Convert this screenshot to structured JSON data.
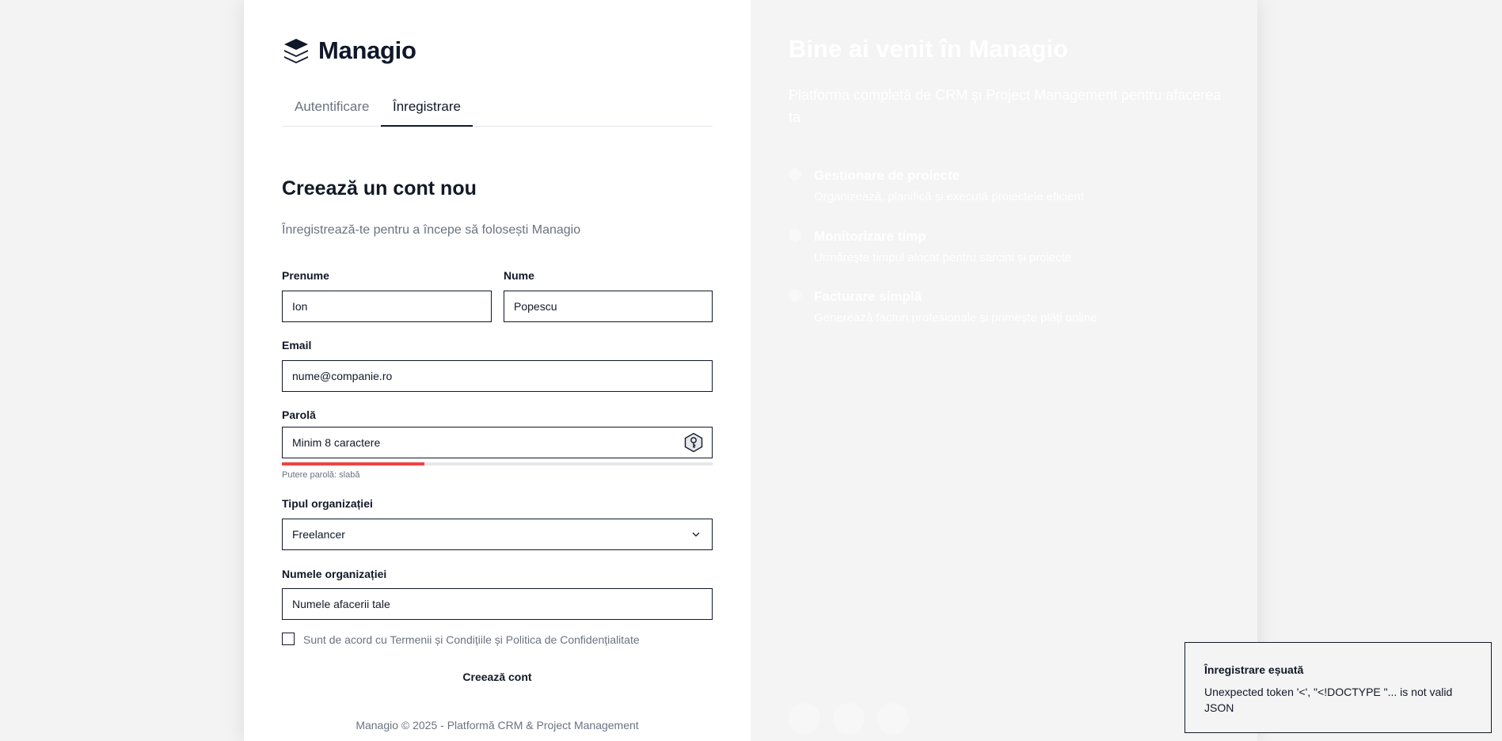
{
  "brand": {
    "name": "Managio"
  },
  "tabs": [
    {
      "label": "Autentificare",
      "active": false
    },
    {
      "label": "Înregistrare",
      "active": true
    }
  ],
  "form": {
    "title": "Creează un cont nou",
    "subtitle": "Înregistrează-te pentru a începe să folosești Managio",
    "first_name": {
      "label": "Prenume",
      "placeholder": "Ion",
      "value": ""
    },
    "last_name": {
      "label": "Nume",
      "placeholder": "Popescu",
      "value": ""
    },
    "email": {
      "label": "Email",
      "placeholder": "nume@companie.ro",
      "value": ""
    },
    "password": {
      "label": "Parolă",
      "placeholder": "Minim 8 caractere",
      "value": "",
      "strength_text": "Putere parolă: slabă",
      "strength_fraction": 0.33,
      "strength_color": "#ef4444"
    },
    "org_type": {
      "label": "Tipul organizației",
      "selected": "Freelancer"
    },
    "org_name": {
      "label": "Numele organizației",
      "placeholder": "Numele afacerii tale",
      "value": ""
    },
    "terms": {
      "label": "Sunt de acord cu Termenii și Condițiile și Politica de Confidențialitate",
      "checked": false
    },
    "submit_label": "Creează cont"
  },
  "footer": {
    "text": "Managio © 2025 - Platformă CRM & Project Management"
  },
  "welcome": {
    "title": "Bine ai venit în Managio",
    "description": "Platforma completă de CRM și Project Management pentru afacerea ta",
    "features": [
      {
        "title": "Gestionare de proiecte",
        "description": "Organizează, planifică și execută proiectele eficient"
      },
      {
        "title": "Monitorizare timp",
        "description": "Urmărește timpul alocat pentru sarcini și proiecte"
      },
      {
        "title": "Facturare simplă",
        "description": "Generează facturi profesionale și primește plăți online"
      }
    ]
  },
  "toast": {
    "title": "Înregistrare eșuată",
    "message": "Unexpected token '<', \"<!DOCTYPE \"... is not valid JSON"
  },
  "colors": {
    "primary": "#111827",
    "muted": "#6b7280",
    "danger": "#ef4444",
    "panel_bg": "#f4f4f4",
    "page_bg": "#f3f3f3"
  },
  "icons": {
    "logo": "layers-icon",
    "password_toggle": "key-icon",
    "select_arrow": "chevron-down-icon"
  }
}
